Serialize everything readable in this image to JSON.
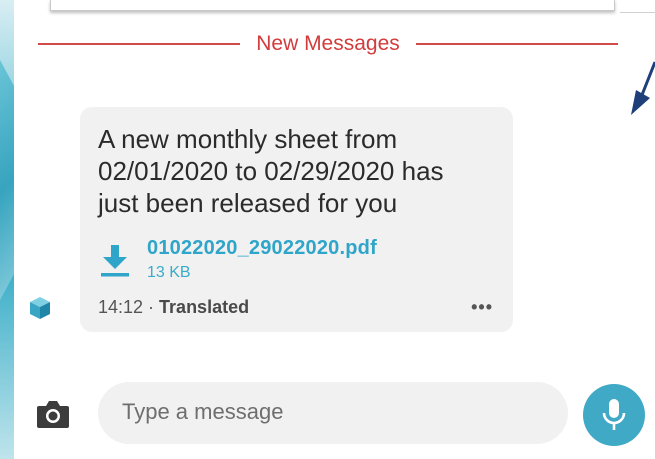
{
  "divider": {
    "label": "New Messages"
  },
  "message": {
    "lines": [
      "A new monthly sheet from",
      "02/01/2020 to 02/29/2020 has",
      "just been released for you"
    ],
    "attachment": {
      "file_name": "01022020_29022020.pdf",
      "file_size": "13 KB",
      "icon": "download-icon"
    },
    "time": "14:12",
    "separator": " · ",
    "status": "Translated",
    "more_icon": "•••"
  },
  "composer": {
    "placeholder": "Type a message",
    "camera_icon": "camera-icon",
    "mic_icon": "microphone-icon"
  },
  "colors": {
    "accent": "#3fa9c6",
    "divider": "#d23c3c",
    "bubble": "#f1f1f1"
  }
}
